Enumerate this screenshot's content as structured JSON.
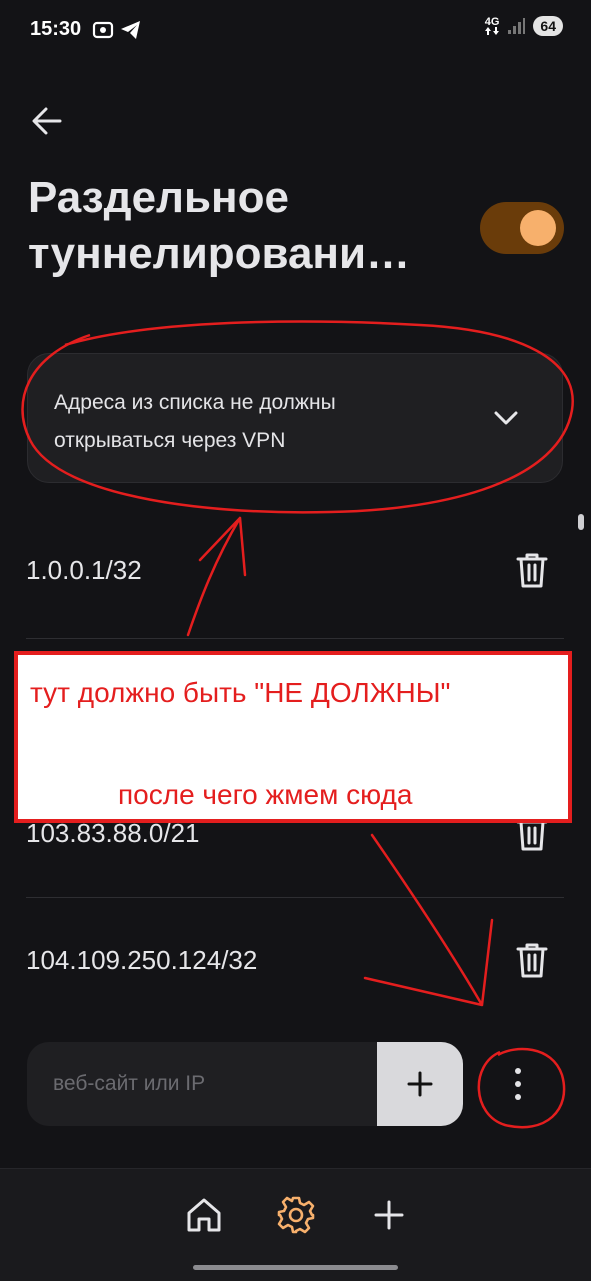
{
  "status_bar": {
    "time": "15:30",
    "network": "4G",
    "battery": "64"
  },
  "header": {
    "title_line1": "Раздельное",
    "title_line2": "туннелировани…",
    "toggle_on": true
  },
  "mode_select": {
    "line1": "Адреса из списка не должны",
    "line2": "открываться через VPN"
  },
  "entries": [
    "1.0.0.1/32",
    "103.83.88.0/21",
    "104.109.250.124/32"
  ],
  "add_field": {
    "placeholder": "веб-сайт или IP",
    "value": ""
  },
  "annotation": {
    "line1": "тут должно быть \"НЕ ДОЛЖНЫ\"",
    "line2": "после чего жмем сюда"
  },
  "colors": {
    "accent": "#f7b06c",
    "toggle_track": "#6a3c0a",
    "annotation_red": "#e41e1e",
    "background": "#131316"
  },
  "icons": {
    "back": "arrow-left-icon",
    "chevron": "chevron-down-icon",
    "trash": "trash-icon",
    "add": "plus-icon",
    "more": "more-vertical-icon",
    "nav_home": "home-icon",
    "nav_settings": "gear-icon",
    "nav_add": "plus-icon"
  }
}
